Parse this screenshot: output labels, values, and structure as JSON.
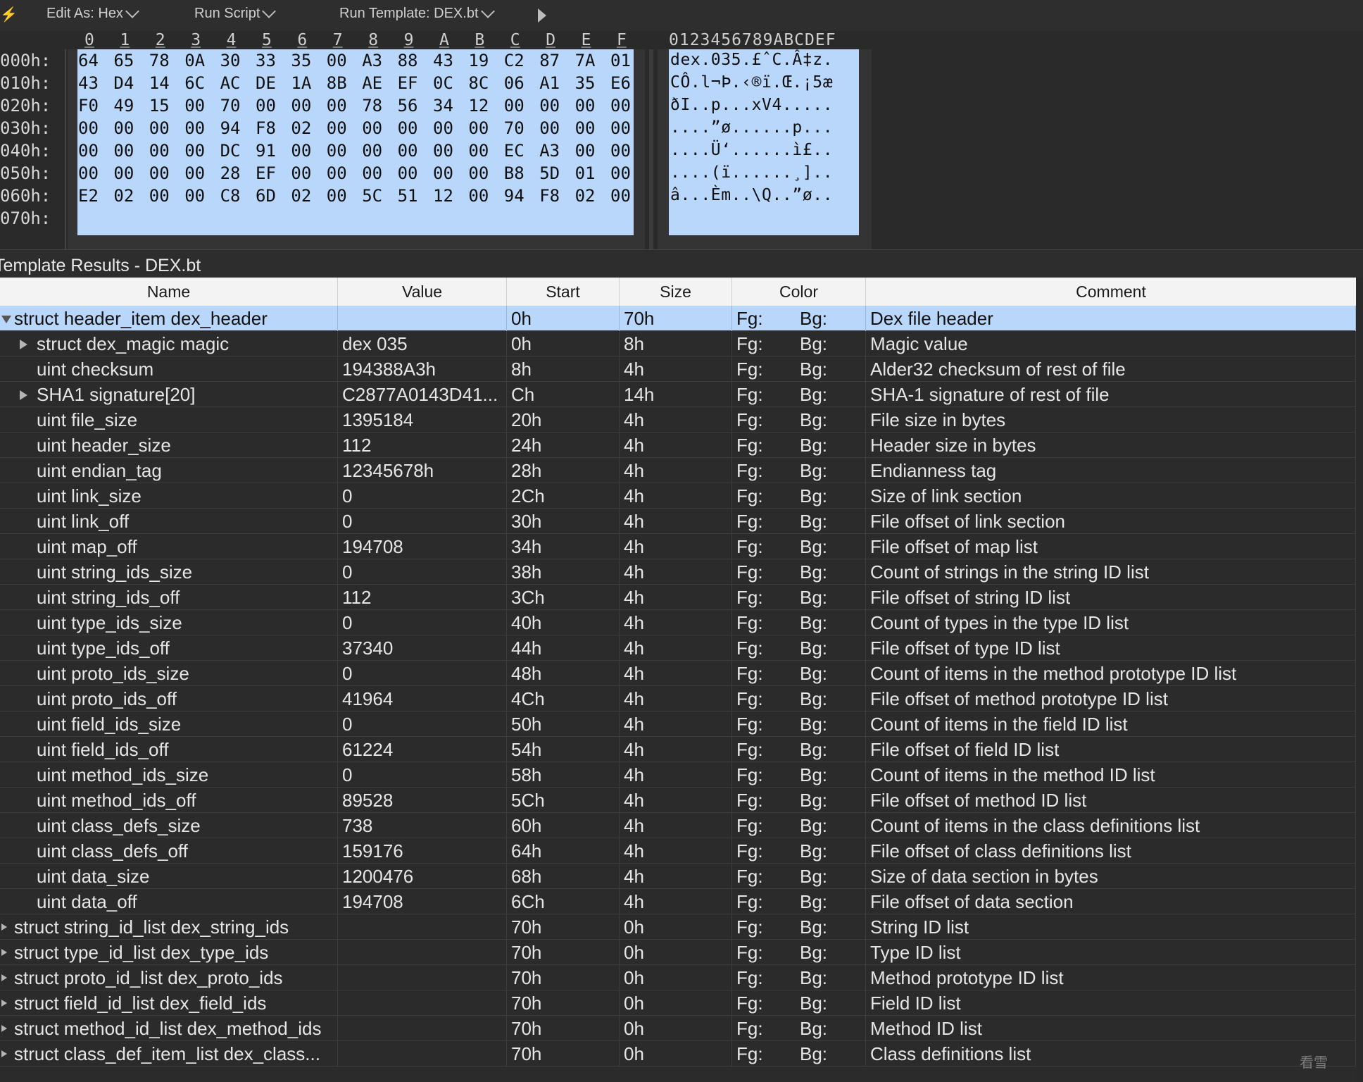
{
  "toolbar": {
    "edit_as": "Edit As: Hex",
    "run_script": "Run Script",
    "run_template": "Run Template: DEX.bt"
  },
  "hex": {
    "columns": [
      "0",
      "1",
      "2",
      "3",
      "4",
      "5",
      "6",
      "7",
      "8",
      "9",
      "A",
      "B",
      "C",
      "D",
      "E",
      "F"
    ],
    "ascii_header": "0123456789ABCDEF",
    "rows": [
      {
        "offset": "000h:",
        "bytes": [
          "64",
          "65",
          "78",
          "0A",
          "30",
          "33",
          "35",
          "00",
          "A3",
          "88",
          "43",
          "19",
          "C2",
          "87",
          "7A",
          "01"
        ],
        "ascii": "dex.035.£ˆC.Â‡z."
      },
      {
        "offset": "010h:",
        "bytes": [
          "43",
          "D4",
          "14",
          "6C",
          "AC",
          "DE",
          "1A",
          "8B",
          "AE",
          "EF",
          "0C",
          "8C",
          "06",
          "A1",
          "35",
          "E6"
        ],
        "ascii": "CÔ.l¬Þ.‹®ï.Œ.¡5æ"
      },
      {
        "offset": "020h:",
        "bytes": [
          "F0",
          "49",
          "15",
          "00",
          "70",
          "00",
          "00",
          "00",
          "78",
          "56",
          "34",
          "12",
          "00",
          "00",
          "00",
          "00"
        ],
        "ascii": "ðI..p...xV4....."
      },
      {
        "offset": "030h:",
        "bytes": [
          "00",
          "00",
          "00",
          "00",
          "94",
          "F8",
          "02",
          "00",
          "00",
          "00",
          "00",
          "00",
          "70",
          "00",
          "00",
          "00"
        ],
        "ascii": "....”ø......p..."
      },
      {
        "offset": "040h:",
        "bytes": [
          "00",
          "00",
          "00",
          "00",
          "DC",
          "91",
          "00",
          "00",
          "00",
          "00",
          "00",
          "00",
          "EC",
          "A3",
          "00",
          "00"
        ],
        "ascii": "....Ü‘......ì£.."
      },
      {
        "offset": "050h:",
        "bytes": [
          "00",
          "00",
          "00",
          "00",
          "28",
          "EF",
          "00",
          "00",
          "00",
          "00",
          "00",
          "00",
          "B8",
          "5D",
          "01",
          "00"
        ],
        "ascii": "....(ï......¸]..",
        "note": ""
      },
      {
        "offset": "060h:",
        "bytes": [
          "E2",
          "02",
          "00",
          "00",
          "C8",
          "6D",
          "02",
          "00",
          "5C",
          "51",
          "12",
          "00",
          "94",
          "F8",
          "02",
          "00"
        ],
        "ascii": "â...Èm..\\Q..”ø.."
      },
      {
        "offset": "070h:",
        "bytes": [],
        "ascii": ""
      }
    ]
  },
  "template": {
    "title": "Template Results - DEX.bt",
    "headers": {
      "name": "Name",
      "value": "Value",
      "start": "Start",
      "size": "Size",
      "color": "Color",
      "comment": "Comment"
    },
    "rows": [
      {
        "name": "struct header_item dex_header",
        "value": "",
        "start": "0h",
        "size": "70h",
        "fg": "Fg:",
        "bg": "Bg:",
        "comment": "Dex file header"
      },
      {
        "name": "struct dex_magic magic",
        "value": "dex 035",
        "start": "0h",
        "size": "8h",
        "fg": "Fg:",
        "bg": "Bg:",
        "comment": "Magic value"
      },
      {
        "name": "uint checksum",
        "value": "194388A3h",
        "start": "8h",
        "size": "4h",
        "fg": "Fg:",
        "bg": "Bg:",
        "comment": "Alder32 checksum of rest of file"
      },
      {
        "name": "SHA1 signature[20]",
        "value": "C2877A0143D41...",
        "start": "Ch",
        "size": "14h",
        "fg": "Fg:",
        "bg": "Bg:",
        "comment": "SHA-1 signature of rest of file"
      },
      {
        "name": "uint file_size",
        "value": "1395184",
        "start": "20h",
        "size": "4h",
        "fg": "Fg:",
        "bg": "Bg:",
        "comment": "File size in bytes"
      },
      {
        "name": "uint header_size",
        "value": "112",
        "start": "24h",
        "size": "4h",
        "fg": "Fg:",
        "bg": "Bg:",
        "comment": "Header size in bytes"
      },
      {
        "name": "uint endian_tag",
        "value": "12345678h",
        "start": "28h",
        "size": "4h",
        "fg": "Fg:",
        "bg": "Bg:",
        "comment": "Endianness tag"
      },
      {
        "name": "uint link_size",
        "value": "0",
        "start": "2Ch",
        "size": "4h",
        "fg": "Fg:",
        "bg": "Bg:",
        "comment": "Size of link section"
      },
      {
        "name": "uint link_off",
        "value": "0",
        "start": "30h",
        "size": "4h",
        "fg": "Fg:",
        "bg": "Bg:",
        "comment": "File offset of link section"
      },
      {
        "name": "uint map_off",
        "value": "194708",
        "start": "34h",
        "size": "4h",
        "fg": "Fg:",
        "bg": "Bg:",
        "comment": "File offset of map list"
      },
      {
        "name": "uint string_ids_size",
        "value": "0",
        "start": "38h",
        "size": "4h",
        "fg": "Fg:",
        "bg": "Bg:",
        "comment": "Count of strings in the string ID list"
      },
      {
        "name": "uint string_ids_off",
        "value": "112",
        "start": "3Ch",
        "size": "4h",
        "fg": "Fg:",
        "bg": "Bg:",
        "comment": "File offset of string ID list"
      },
      {
        "name": "uint type_ids_size",
        "value": "0",
        "start": "40h",
        "size": "4h",
        "fg": "Fg:",
        "bg": "Bg:",
        "comment": "Count of types in the type ID list"
      },
      {
        "name": "uint type_ids_off",
        "value": "37340",
        "start": "44h",
        "size": "4h",
        "fg": "Fg:",
        "bg": "Bg:",
        "comment": "File offset of type ID list"
      },
      {
        "name": "uint proto_ids_size",
        "value": "0",
        "start": "48h",
        "size": "4h",
        "fg": "Fg:",
        "bg": "Bg:",
        "comment": "Count of items in the method prototype ID list"
      },
      {
        "name": "uint proto_ids_off",
        "value": "41964",
        "start": "4Ch",
        "size": "4h",
        "fg": "Fg:",
        "bg": "Bg:",
        "comment": "File offset of method prototype ID list"
      },
      {
        "name": "uint field_ids_size",
        "value": "0",
        "start": "50h",
        "size": "4h",
        "fg": "Fg:",
        "bg": "Bg:",
        "comment": "Count of items in the field ID list"
      },
      {
        "name": "uint field_ids_off",
        "value": "61224",
        "start": "54h",
        "size": "4h",
        "fg": "Fg:",
        "bg": "Bg:",
        "comment": "File offset of field ID list"
      },
      {
        "name": "uint method_ids_size",
        "value": "0",
        "start": "58h",
        "size": "4h",
        "fg": "Fg:",
        "bg": "Bg:",
        "comment": "Count of items in the method ID list"
      },
      {
        "name": "uint method_ids_off",
        "value": "89528",
        "start": "5Ch",
        "size": "4h",
        "fg": "Fg:",
        "bg": "Bg:",
        "comment": "File offset of method ID list"
      },
      {
        "name": "uint class_defs_size",
        "value": "738",
        "start": "60h",
        "size": "4h",
        "fg": "Fg:",
        "bg": "Bg:",
        "comment": "Count of items in the class definitions list"
      },
      {
        "name": "uint class_defs_off",
        "value": "159176",
        "start": "64h",
        "size": "4h",
        "fg": "Fg:",
        "bg": "Bg:",
        "comment": "File offset of class definitions list"
      },
      {
        "name": "uint data_size",
        "value": "1200476",
        "start": "68h",
        "size": "4h",
        "fg": "Fg:",
        "bg": "Bg:",
        "comment": "Size of data section in bytes"
      },
      {
        "name": "uint data_off",
        "value": "194708",
        "start": "6Ch",
        "size": "4h",
        "fg": "Fg:",
        "bg": "Bg:",
        "comment": "File offset of data section"
      },
      {
        "name": "struct string_id_list dex_string_ids",
        "value": "",
        "start": "70h",
        "size": "0h",
        "fg": "Fg:",
        "bg": "Bg:",
        "comment": "String ID list"
      },
      {
        "name": "struct type_id_list dex_type_ids",
        "value": "",
        "start": "70h",
        "size": "0h",
        "fg": "Fg:",
        "bg": "Bg:",
        "comment": "Type ID list"
      },
      {
        "name": "struct proto_id_list dex_proto_ids",
        "value": "",
        "start": "70h",
        "size": "0h",
        "fg": "Fg:",
        "bg": "Bg:",
        "comment": "Method prototype ID list"
      },
      {
        "name": "struct field_id_list dex_field_ids",
        "value": "",
        "start": "70h",
        "size": "0h",
        "fg": "Fg:",
        "bg": "Bg:",
        "comment": "Field ID list"
      },
      {
        "name": "struct method_id_list dex_method_ids",
        "value": "",
        "start": "70h",
        "size": "0h",
        "fg": "Fg:",
        "bg": "Bg:",
        "comment": "Method ID list"
      },
      {
        "name": "struct class_def_item_list dex_class...",
        "value": "",
        "start": "70h",
        "size": "0h",
        "fg": "Fg:",
        "bg": "Bg:",
        "comment": "Class definitions list"
      }
    ]
  },
  "watermark": "看雪",
  "colors": {
    "selection": "#b9d6fb",
    "background": "#2b2b2b",
    "header_bg": "#f3f3f3"
  }
}
